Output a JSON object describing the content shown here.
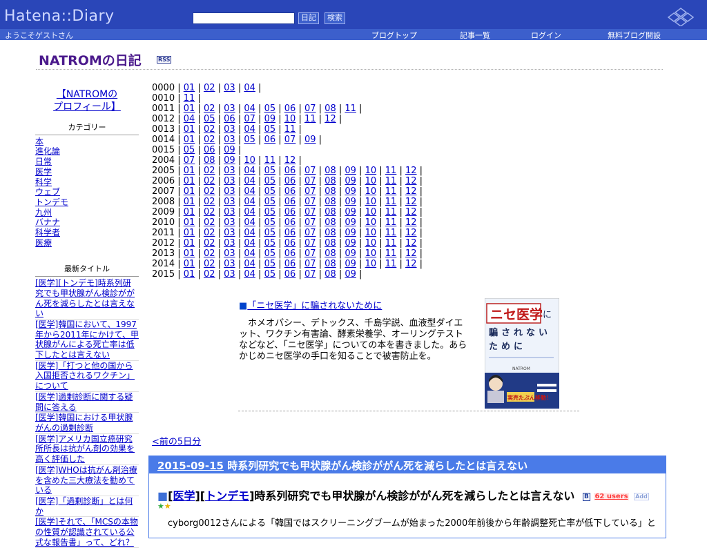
{
  "header": {
    "logo": "Hatena::Diary",
    "search_value": "",
    "diary_button": "日記",
    "search_button": "検索",
    "welcome": "ようこそゲストさん",
    "nav": [
      "ブログトップ",
      "記事一覧",
      "ログイン",
      "無料ブログ開設"
    ]
  },
  "diary": {
    "title": "NATROMの日記",
    "rss": "RSS"
  },
  "sidebar": {
    "profile_line1": "【NATROMの",
    "profile_line2": "プロフィール】",
    "categories_head": "カテゴリー",
    "categories": [
      "本",
      "進化論",
      "日常",
      "医学",
      "科学",
      "ウェブ",
      "トンデモ",
      "九州",
      "バナナ",
      "科学者",
      "医療"
    ],
    "titles_head": "最新タイトル",
    "titles": [
      "[医学][トンデモ]時系列研究でも甲状腺がん検診ががん死を減らしたとは言えない",
      "[医学]韓国において、1997年から2011年にかけて、甲状腺がんによる死亡率は低下したとは言えない",
      "[医学]「打つと他の国から入国拒否されるワクチン」について",
      "[医学]過剰診断に関する疑問に答える",
      "[医学]韓国における甲状腺がんの過剰診断",
      "[医学]アメリカ国立癌研究所所長は抗がん剤の効果を高く評価した",
      "[医学]WHOは抗がん剤治療を含めた三大療法を勧めている",
      "[医学]「過剰診断」とは何か",
      "[医学]それで、「MCSの本物の性質が認識されている公式な報告書」って、どれ？"
    ]
  },
  "archive": [
    {
      "year": "0000",
      "months": [
        "01",
        "02",
        "03",
        "04"
      ]
    },
    {
      "year": "0010",
      "months": [
        "11"
      ]
    },
    {
      "year": "0011",
      "months": [
        "01",
        "02",
        "03",
        "04",
        "05",
        "06",
        "07",
        "08",
        "11"
      ]
    },
    {
      "year": "0012",
      "months": [
        "04",
        "05",
        "06",
        "07",
        "09",
        "10",
        "11",
        "12"
      ]
    },
    {
      "year": "0013",
      "months": [
        "01",
        "02",
        "03",
        "04",
        "05",
        "11"
      ]
    },
    {
      "year": "0014",
      "months": [
        "01",
        "02",
        "03",
        "05",
        "06",
        "07",
        "09"
      ]
    },
    {
      "year": "0015",
      "months": [
        "05",
        "06",
        "09"
      ]
    },
    {
      "year": "2004",
      "months": [
        "07",
        "08",
        "09",
        "10",
        "11",
        "12"
      ]
    },
    {
      "year": "2005",
      "months": [
        "01",
        "02",
        "03",
        "04",
        "05",
        "06",
        "07",
        "08",
        "09",
        "10",
        "11",
        "12"
      ]
    },
    {
      "year": "2006",
      "months": [
        "01",
        "02",
        "03",
        "04",
        "05",
        "06",
        "07",
        "08",
        "09",
        "10",
        "11",
        "12"
      ]
    },
    {
      "year": "2007",
      "months": [
        "01",
        "02",
        "03",
        "04",
        "05",
        "06",
        "07",
        "08",
        "09",
        "10",
        "11",
        "12"
      ]
    },
    {
      "year": "2008",
      "months": [
        "01",
        "02",
        "03",
        "04",
        "05",
        "06",
        "07",
        "08",
        "09",
        "10",
        "11",
        "12"
      ]
    },
    {
      "year": "2009",
      "months": [
        "01",
        "02",
        "03",
        "04",
        "05",
        "06",
        "07",
        "08",
        "09",
        "10",
        "11",
        "12"
      ]
    },
    {
      "year": "2010",
      "months": [
        "01",
        "02",
        "03",
        "04",
        "05",
        "06",
        "07",
        "08",
        "09",
        "10",
        "11",
        "12"
      ]
    },
    {
      "year": "2011",
      "months": [
        "01",
        "02",
        "03",
        "04",
        "05",
        "06",
        "07",
        "08",
        "09",
        "10",
        "11",
        "12"
      ]
    },
    {
      "year": "2012",
      "months": [
        "01",
        "02",
        "03",
        "04",
        "05",
        "06",
        "07",
        "08",
        "09",
        "10",
        "11",
        "12"
      ]
    },
    {
      "year": "2013",
      "months": [
        "01",
        "02",
        "03",
        "04",
        "05",
        "06",
        "07",
        "08",
        "09",
        "10",
        "11",
        "12"
      ]
    },
    {
      "year": "2014",
      "months": [
        "01",
        "02",
        "03",
        "04",
        "05",
        "06",
        "07",
        "08",
        "09",
        "10",
        "11",
        "12"
      ]
    },
    {
      "year": "2015",
      "months": [
        "01",
        "02",
        "03",
        "04",
        "05",
        "06",
        "07",
        "08",
        "09"
      ]
    }
  ],
  "book": {
    "square": "■",
    "link": "「ニセ医学」に騙されないために",
    "description": "　ホメオパシー、デトックス、千島学説、血液型ダイエット、ワクチン有害論、酵素栄養学、オーリングテストなどなど、「ニセ医学」についての本を書きました。あらかじめニセ医学の手口を知ることで被害防止を。",
    "cover_title": "ニセ医学",
    "cover_ni": "に",
    "cover_line2": "騙されない",
    "cover_line3": "ために",
    "cover_author": "NATROM",
    "cover_tagline": "実売たぶん移動！"
  },
  "prev_link": "<前の5日分",
  "entry": {
    "date": "2015-09-15",
    "header_title": "時系列研究でも甲状腺がん検診ががん死を減らしたとは言えない",
    "square": "■",
    "cat1": "医学",
    "cat2": "トンデモ",
    "title": "時系列研究でも甲状腺がん検診ががん死を減らしたとは言えない",
    "hb_icon": "B",
    "users": "62 users",
    "add_star": "Add",
    "body": "cyborg0012さんによる「韓国ではスクリーニングブームが始まった2000年前後から年齢調整死亡率が低下している」と"
  },
  "colors": {
    "hatena_bar": "#2a46b8",
    "hatena_subbar": "#3c5fcc",
    "title_purple": "#4b1a8c",
    "link_blue": "#0000cc",
    "day_header": "#4a7be8"
  }
}
